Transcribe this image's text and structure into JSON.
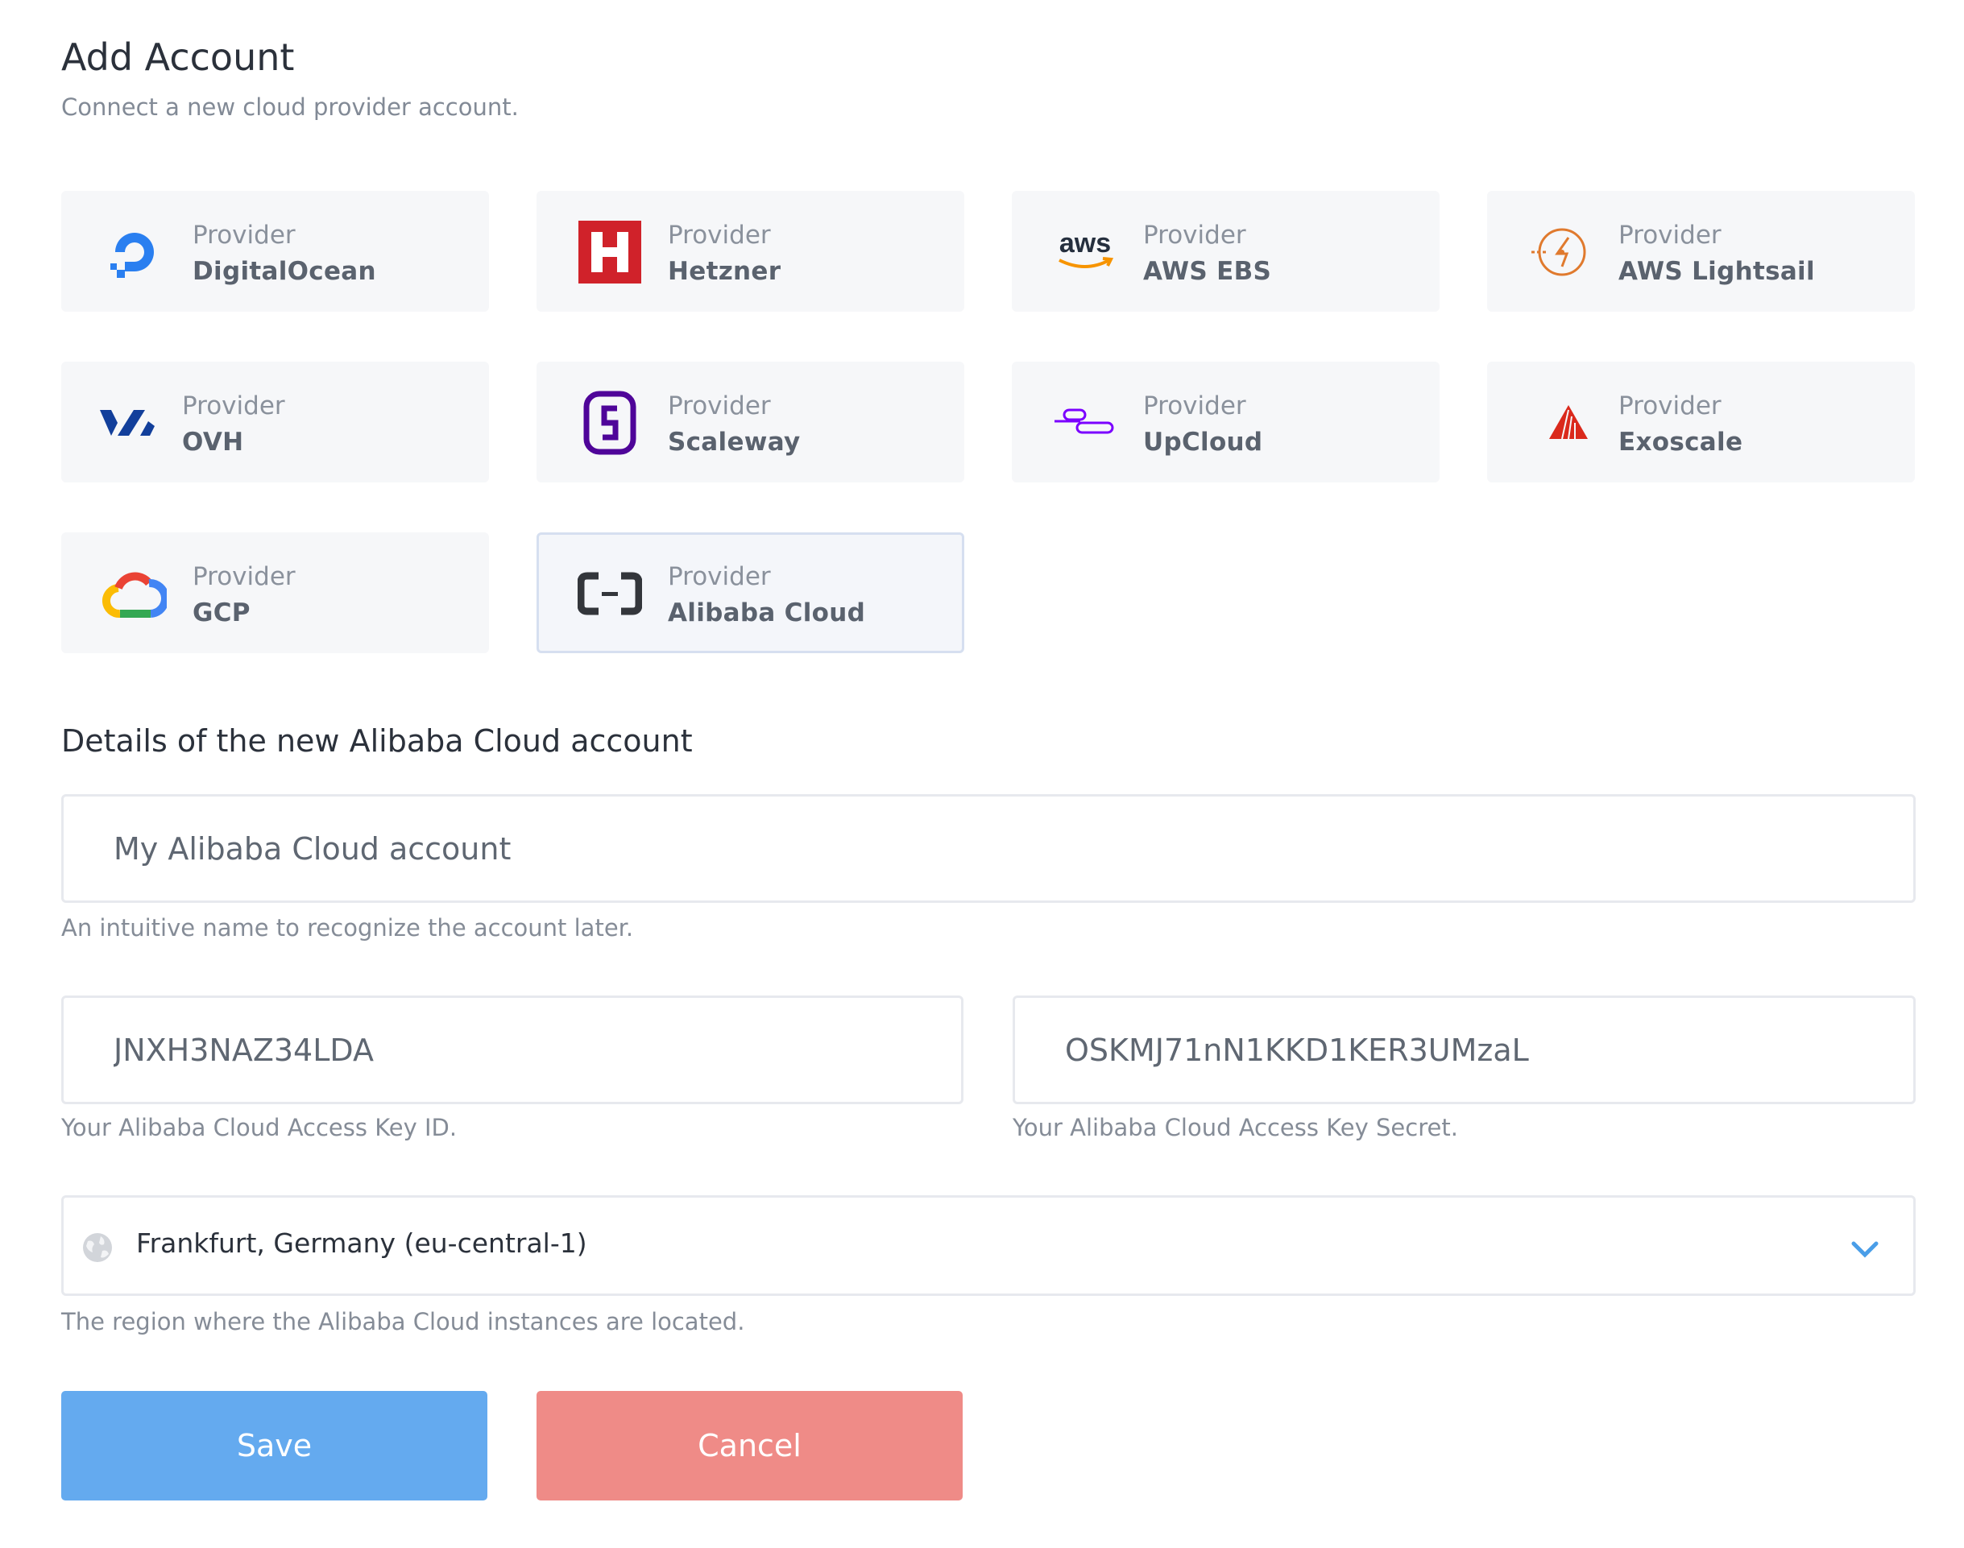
{
  "header": {
    "title": "Add Account",
    "subtitle": "Connect a new cloud provider account."
  },
  "providers": [
    {
      "caption": "Provider",
      "name": "DigitalOcean",
      "icon": "digitalocean-icon",
      "selected": false
    },
    {
      "caption": "Provider",
      "name": "Hetzner",
      "icon": "hetzner-icon",
      "selected": false
    },
    {
      "caption": "Provider",
      "name": "AWS EBS",
      "icon": "aws-icon",
      "icon_text": "aws",
      "selected": false
    },
    {
      "caption": "Provider",
      "name": "AWS Lightsail",
      "icon": "aws-lightsail-icon",
      "selected": false
    },
    {
      "caption": "Provider",
      "name": "OVH",
      "icon": "ovh-icon",
      "selected": false
    },
    {
      "caption": "Provider",
      "name": "Scaleway",
      "icon": "scaleway-icon",
      "selected": false
    },
    {
      "caption": "Provider",
      "name": "UpCloud",
      "icon": "upcloud-icon",
      "selected": false
    },
    {
      "caption": "Provider",
      "name": "Exoscale",
      "icon": "exoscale-icon",
      "selected": false
    },
    {
      "caption": "Provider",
      "name": "GCP",
      "icon": "gcp-icon",
      "selected": false
    },
    {
      "caption": "Provider",
      "name": "Alibaba Cloud",
      "icon": "alibaba-cloud-icon",
      "selected": true
    }
  ],
  "details": {
    "title": "Details of the new Alibaba Cloud account",
    "account_name": {
      "value": "My Alibaba Cloud account",
      "hint": "An intuitive name to recognize the account later."
    },
    "access_key_id": {
      "value": "JNXH3NAZ34LDA",
      "hint": "Your Alibaba Cloud Access Key ID."
    },
    "access_key_secret": {
      "value": "OSKMJ71nN1KKD1KER3UMzaL",
      "hint": "Your Alibaba Cloud Access Key Secret."
    },
    "region": {
      "value": "Frankfurt, Germany (eu-central-1)",
      "hint": "The region where the Alibaba Cloud instances are located."
    }
  },
  "actions": {
    "save_label": "Save",
    "cancel_label": "Cancel"
  },
  "colors": {
    "save": "#64aaef",
    "cancel": "#ef8b87",
    "selected_border": "#d6dff0",
    "chevron": "#4a9ee8"
  }
}
